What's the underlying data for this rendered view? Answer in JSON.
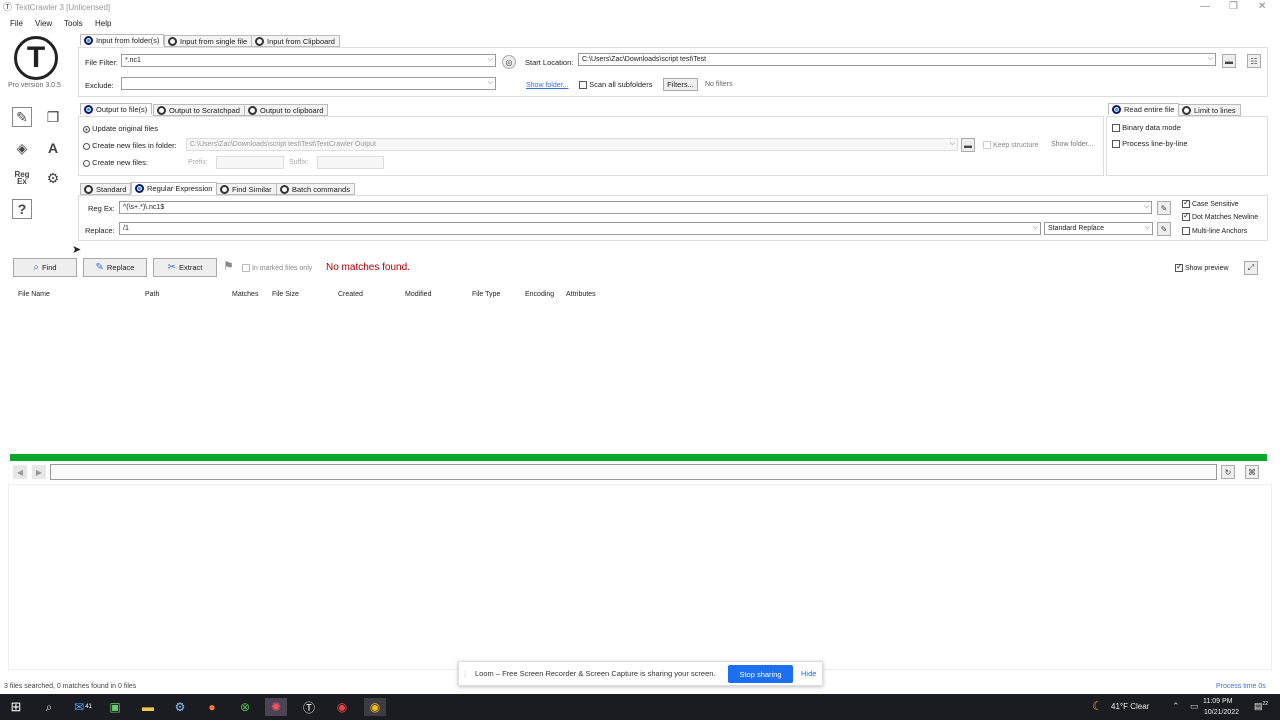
{
  "window": {
    "title": "TextCrawler 3 [Unlicensed]",
    "controls": [
      "—",
      "❐",
      "✕"
    ]
  },
  "menu": [
    "File",
    "View",
    "Tools",
    "Help"
  ],
  "app": {
    "version": "Pro version 3.0.5",
    "logo_letter": "T"
  },
  "input": {
    "tabs": [
      "Input from folder(s)",
      "Input from single file",
      "Input from Clipboard"
    ],
    "active_tab": 0,
    "file_filter_label": "File Filter:",
    "file_filter_value": "*.nc1",
    "exclude_label": "Exclude:",
    "exclude_value": "",
    "start_location_label": "Start Location:",
    "start_location_value": "C:\\Users\\Zac\\Downloads\\script test\\Test",
    "show_folder": "Show folder...",
    "scan_subfolders": "Scan all subfolders",
    "filters_button": "Filters...",
    "filters_status": "No filters"
  },
  "output": {
    "tabs": [
      "Output to file(s)",
      "Output to Scratchpad",
      "Output to clipboard"
    ],
    "update_original": "Update original files",
    "create_in_folder": "Create new files in folder:",
    "folder_value": "C:\\Users\\Zac\\Downloads\\script test\\Test\\TextCrawler Output",
    "keep_structure": "Keep structure",
    "show_folder": "Show folder...",
    "create_new": "Create new files:",
    "prefix_label": "Prefix:",
    "suffix_label": "Suffix:"
  },
  "read": {
    "tabs": [
      "Read entire file",
      "Limit to lines"
    ],
    "binary": "Binary data mode",
    "line_by_line": "Process line-by-line"
  },
  "search": {
    "tabs": [
      "Standard",
      "Regular Expression",
      "Find Similar",
      "Batch commands"
    ],
    "active_tab": 1,
    "regex_label": "Reg Ex:",
    "regex_value": "^(\\s+.*)\\.nc1$",
    "replace_label": "Replace:",
    "replace_value": "/1",
    "replace_mode": "Standard Replace",
    "case_sensitive": "Case Sensitive",
    "dot_newline": "Dot Matches Newline",
    "multiline": "Multi-line Anchors"
  },
  "actions": {
    "find": "Find",
    "replace": "Replace",
    "extract": "Extract",
    "in_marked": "In marked files only",
    "result_message": "No matches found.",
    "show_preview": "Show preview"
  },
  "results": {
    "columns": [
      "File Name",
      "Path",
      "Matches",
      "File Size",
      "Created",
      "Modified",
      "File Type",
      "Encoding",
      "Attributes"
    ],
    "progress": 1.0
  },
  "status": {
    "left": "3 files searched, 0 matches found in 0 files",
    "right": "Process time 0s"
  },
  "loom": {
    "message": "Loom – Free Screen Recorder & Screen Capture is sharing your screen.",
    "stop": "Stop sharing",
    "hide": "Hide"
  },
  "taskbar": {
    "mail_badge": "41",
    "weather": "41°F  Clear",
    "time": "11:09 PM",
    "date": "10/21/2022",
    "notif": "22"
  },
  "colors": {
    "accent": "#1fa3b0",
    "progress": "#0aa82a",
    "link": "#3a6fd8",
    "error": "#b00000",
    "loom_btn": "#1b6ff0"
  }
}
